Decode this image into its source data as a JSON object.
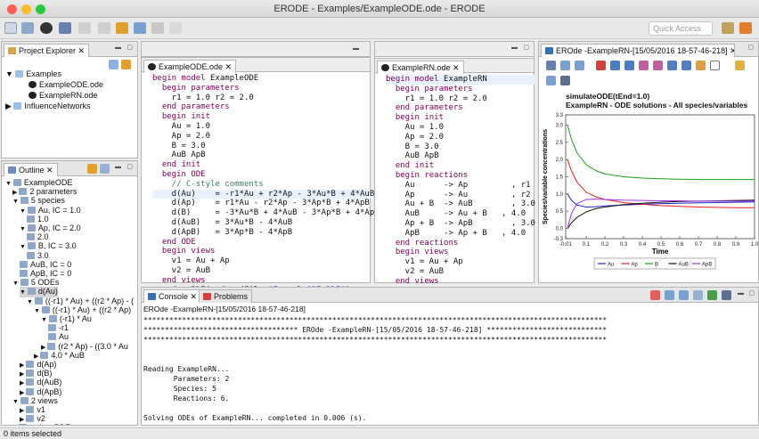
{
  "window": {
    "title": "ERODE - Examples/ExampleODE.ode - ERODE",
    "quick_access": "Quick Access"
  },
  "project_explorer": {
    "tab": "Project Explorer",
    "items": [
      {
        "label": "Examples"
      },
      {
        "label": "ExampleODE.ode"
      },
      {
        "label": "ExampleRN.ode"
      },
      {
        "label": "InfluenceNetworks"
      }
    ]
  },
  "outline": {
    "tab": "Outline",
    "items": [
      "ExampleODE",
      "2 parameters",
      "5 species",
      "Au, IC = 1.0",
      "1.0",
      "Ap, IC = 2.0",
      "2.0",
      "B, IC = 3.0",
      "3.0",
      "AuB, IC = 0",
      "ApB, IC = 0",
      "5 ODEs",
      "d(Au)",
      "((-r1) * Au) + ((r2 * Ap) - (",
      "((-r1) * Au) + ((r2 * Ap)",
      "(-r1) * Au",
      "-r1",
      "Au",
      "(r2 * Ap) - ((3.0 * Au",
      "4.0 * AuB",
      "d(Ap)",
      "d(B)",
      "d(AuB)",
      "d(ApB)",
      "2 views",
      "v1",
      "v2",
      "reduceBDE"
    ]
  },
  "editor1": {
    "tab": "ExampleODE.ode",
    "lines": [
      [
        [
          "kw",
          "begin model "
        ],
        [
          "",
          "ExampleODE"
        ]
      ],
      [
        [
          "kw",
          "  begin parameters"
        ]
      ],
      [
        [
          "",
          "    r1 = 1.0 r2 = 2.0"
        ]
      ],
      [
        [
          "kw",
          "  end parameters"
        ]
      ],
      [
        [
          "kw",
          "  begin init"
        ]
      ],
      [
        [
          "",
          "    Au = 1.0"
        ]
      ],
      [
        [
          "",
          "    Ap = 2.0"
        ]
      ],
      [
        [
          "",
          "    B = 3.0"
        ]
      ],
      [
        [
          "",
          "    AuB ApB"
        ]
      ],
      [
        [
          "kw",
          "  end init"
        ]
      ],
      [
        [
          "kw",
          "  begin ODE"
        ]
      ],
      [
        [
          "cm",
          "    // C-style comments"
        ]
      ],
      [
        [
          "",
          "    d(Au)    = -r1*Au + r2*Ap - 3*Au*B + 4*AuB"
        ]
      ],
      [
        [
          "",
          "    d(Ap)    = r1*Au - r2*Ap - 3*Ap*B + 4*ApB"
        ]
      ],
      [
        [
          "",
          "    d(B)     = -3*Au*B + 4*AuB - 3*Ap*B + 4*ApB"
        ]
      ],
      [
        [
          "",
          "    d(AuB)   = 3*Au*B - 4*AuB"
        ]
      ],
      [
        [
          "",
          "    d(ApB)   = 3*Ap*B - 4*ApB"
        ]
      ],
      [
        [
          "kw",
          "  end ODE"
        ]
      ],
      [
        [
          "kw",
          "  begin views"
        ]
      ],
      [
        [
          "",
          "    v1 = Au + Ap"
        ]
      ],
      [
        [
          "",
          "    v2 = AuB"
        ]
      ],
      [
        [
          "kw",
          "  end views"
        ]
      ],
      [
        [
          "",
          "  reduceBDE(reducedFile="
        ],
        [
          "str",
          "\"ExampleODE_BDE\""
        ],
        [
          "",
          ")"
        ]
      ],
      [
        [
          "kw",
          "end model"
        ]
      ]
    ]
  },
  "editor2": {
    "tab": "ExampleRN.ode",
    "lines": [
      [
        [
          "kw",
          "begin model "
        ],
        [
          "",
          "ExampleRN"
        ]
      ],
      [
        [
          "kw",
          "  begin parameters"
        ]
      ],
      [
        [
          "",
          "    r1 = 1.0 r2 = 2.0"
        ]
      ],
      [
        [
          "kw",
          "  end parameters"
        ]
      ],
      [
        [
          "kw",
          "  begin init"
        ]
      ],
      [
        [
          "",
          "    Au = 1.0"
        ]
      ],
      [
        [
          "",
          "    Ap = 2.0"
        ]
      ],
      [
        [
          "",
          "    B = 3.0"
        ]
      ],
      [
        [
          "",
          "    AuB ApB"
        ]
      ],
      [
        [
          "kw",
          "  end init"
        ]
      ],
      [
        [
          "kw",
          "  begin reactions"
        ]
      ],
      [
        [
          "",
          "    Au      -> Ap         , r1"
        ]
      ],
      [
        [
          "",
          "    Ap      -> Au         , r2"
        ]
      ],
      [
        [
          "",
          "    Au + B  -> AuB        , 3.0"
        ]
      ],
      [
        [
          "",
          "    AuB     -> Au + B   , 4.0"
        ]
      ],
      [
        [
          "",
          "    Ap + B  -> ApB        , 3.0"
        ]
      ],
      [
        [
          "",
          "    ApB     -> Ap + B   , 4.0"
        ]
      ],
      [
        [
          "kw",
          "  end reactions"
        ]
      ],
      [
        [
          "kw",
          "  begin views"
        ]
      ],
      [
        [
          "",
          "    v1 = Au + Ap"
        ]
      ],
      [
        [
          "",
          "    v2 = AuB"
        ]
      ],
      [
        [
          "kw",
          "  end views"
        ]
      ],
      [
        [
          "",
          "  simulateODE(tEnd=1.0)"
        ]
      ],
      [
        [
          "kw",
          "end model"
        ]
      ]
    ]
  },
  "plot": {
    "tab": "EROde -ExampleRN-[15/05/2016 18-57-46-218]",
    "line1": "simulateODE(tEnd=1.0)",
    "line2": "ExampleRN - ODE solutions - All species/variables"
  },
  "chart_data": {
    "type": "line",
    "xlabel": "Time",
    "ylabel": "Species/variable concentrations",
    "xlim": [
      -0.01,
      1.0
    ],
    "ylim": [
      -0.3,
      3.3
    ],
    "xticks": [
      "-0.01",
      "0.1",
      "0.2",
      "0.3",
      "0.4",
      "0.5",
      "0.6",
      "0.7",
      "0.8",
      "0.9",
      "1.0"
    ],
    "yticks": [
      "-0.3",
      "0.0",
      "0.5",
      "1.0",
      "1.5",
      "2.0",
      "2.5",
      "3.0",
      "3.3"
    ],
    "x": [
      0,
      0.02,
      0.05,
      0.1,
      0.15,
      0.2,
      0.3,
      0.4,
      0.5,
      0.6,
      0.7,
      0.8,
      0.9,
      1.0
    ],
    "series": [
      {
        "name": "Au",
        "color": "#2323c8",
        "values": [
          1.0,
          0.82,
          0.68,
          0.62,
          0.63,
          0.65,
          0.68,
          0.7,
          0.72,
          0.73,
          0.74,
          0.75,
          0.76,
          0.77
        ]
      },
      {
        "name": "Ap",
        "color": "#e02020",
        "values": [
          2.0,
          1.68,
          1.35,
          1.05,
          0.92,
          0.84,
          0.75,
          0.7,
          0.66,
          0.64,
          0.62,
          0.61,
          0.6,
          0.6
        ]
      },
      {
        "name": "B",
        "color": "#19a019",
        "values": [
          3.0,
          2.6,
          2.2,
          1.85,
          1.68,
          1.58,
          1.5,
          1.46,
          1.44,
          1.43,
          1.42,
          1.42,
          1.42,
          1.42
        ]
      },
      {
        "name": "AuB",
        "color": "#111111",
        "values": [
          0.0,
          0.15,
          0.32,
          0.48,
          0.57,
          0.62,
          0.69,
          0.73,
          0.76,
          0.78,
          0.79,
          0.8,
          0.81,
          0.82
        ]
      },
      {
        "name": "ApB",
        "color": "#9b35e0",
        "values": [
          0.0,
          0.42,
          0.72,
          0.84,
          0.85,
          0.84,
          0.82,
          0.81,
          0.8,
          0.8,
          0.79,
          0.79,
          0.79,
          0.79
        ]
      }
    ]
  },
  "console": {
    "tab": "Console",
    "tab2": "Problems",
    "header": "EROde -ExampleRN-[15/05/2016 18-57-46-218]",
    "lines": [
      "************************************************************************************************************",
      "************************************ EROde -ExampleRN-[15/05/2016 18-57-46-218] ****************************",
      "************************************************************************************************************",
      "",
      "",
      "Reading ExampleRN...",
      "       Parameters: 2",
      "       Species: 5",
      "       Reactions: 6.",
      "",
      "Solving ODEs of ExampleRN... completed in 0.006 (s)."
    ]
  },
  "status": {
    "text": "0 items selected"
  }
}
